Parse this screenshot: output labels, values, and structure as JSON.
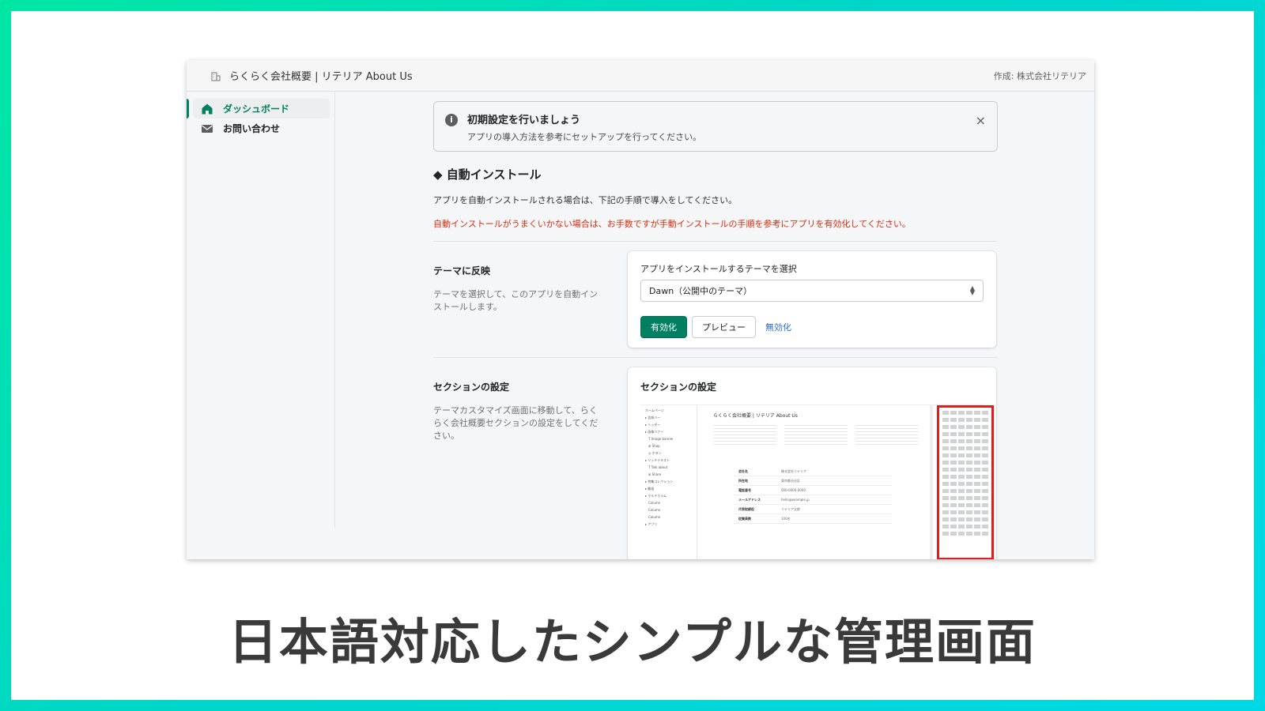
{
  "window": {
    "title": "らくらく会社概要 | リテリア About Us",
    "creator": "作成: 株式会社リテリア"
  },
  "sidebar": {
    "items": [
      {
        "label": "ダッシュボード",
        "icon": "home-icon",
        "active": true
      },
      {
        "label": "お問い合わせ",
        "icon": "mail-icon",
        "active": false
      }
    ]
  },
  "banner": {
    "title": "初期設定を行いましょう",
    "description": "アプリの導入方法を参考にセットアップを行ってください。",
    "close_icon": "×"
  },
  "auto_install": {
    "heading": "◆ 自動インストール",
    "description": "アプリを自動インストールされる場合は、下記の手順で導入をしてください。",
    "warning": "自動インストールがうまくいかない場合は、お手数ですが手動インストールの手順を参考にアプリを有効化してください。"
  },
  "theme_section": {
    "title": "テーマに反映",
    "description": "テーマを選択して、このアプリを自動インストールします。",
    "select_label": "アプリをインストールするテーマを選択",
    "select_value": "Dawn（公開中のテーマ）",
    "enable_button": "有効化",
    "preview_button": "プレビュー",
    "disable_link": "無効化"
  },
  "section_settings": {
    "title": "セクションの設定",
    "description": "テーマカスタマイズ画面に移動して、らくらく会社概要セクションの設定をしてください。",
    "card_title": "セクションの設定",
    "preview_title": "らくらく会社概要 | リテリア About Us",
    "preview_table": [
      {
        "label": "会社名",
        "value": "株式会社リテリア"
      },
      {
        "label": "所在地",
        "value": "東京都渋谷区"
      },
      {
        "label": "電話番号",
        "value": "000-0000-0000"
      },
      {
        "label": "メールアドレス",
        "value": "hello@example.jp"
      },
      {
        "label": "代表取締役",
        "value": "リテリア太郎"
      },
      {
        "label": "従業員数",
        "value": "100名"
      }
    ]
  },
  "caption": "日本語対応したシンプルな管理画面",
  "colors": {
    "primary": "#008060",
    "warning_text": "#d72c0d",
    "link": "#2c6ecb",
    "highlight_border": "#e11d1d"
  }
}
